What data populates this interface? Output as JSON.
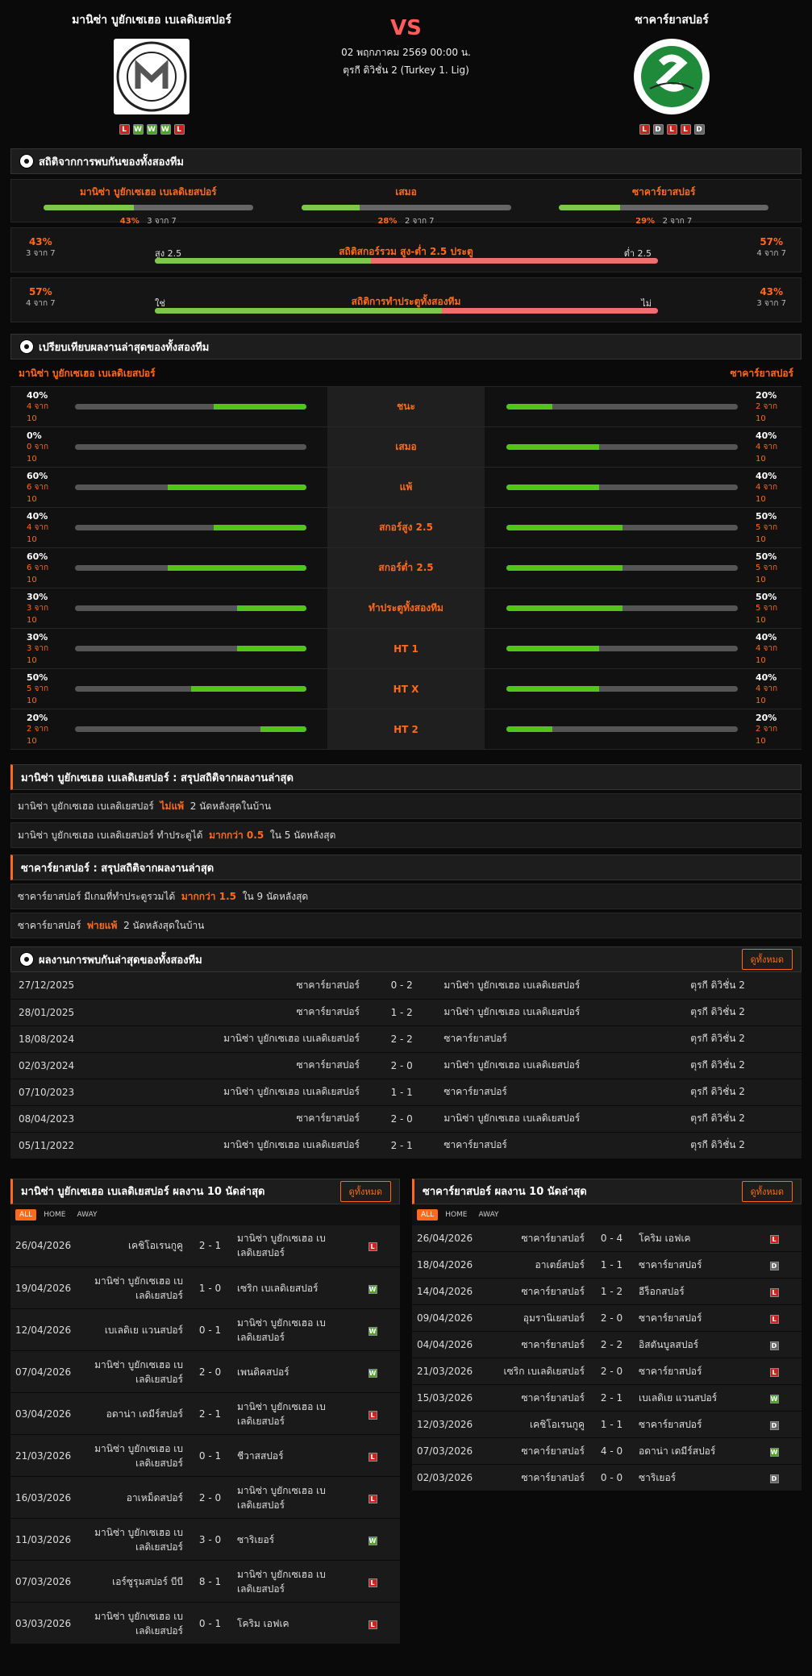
{
  "match": {
    "home": "มานิซ่า บูยักเซเฮอ เบเลดิเยสปอร์",
    "away": "ซาคาร์ยาสปอร์",
    "vs": "VS",
    "datetime": "02 พฤกภาคม 2569 00:00 น.",
    "league": "ตุรกี ดิวิชั่น 2 (Turkey 1. Lig)",
    "home_form": [
      "L",
      "W",
      "W",
      "W",
      "L"
    ],
    "away_form": [
      "L",
      "D",
      "L",
      "L",
      "D"
    ],
    "home_logo_text": "Manisa Futbol Kulübü 2019",
    "away_logo_text": "SAKARYASPOR"
  },
  "h2h_stats": {
    "title": "สถิติจากการพบกันของทั้งสองทีม",
    "home": {
      "label": "มานิซ่า บูยักเซเฮอ เบเลดิเยสปอร์",
      "pct": "43%",
      "count": "3 จาก 7",
      "value": 0.43
    },
    "draw": {
      "label": "เสมอ",
      "pct": "28%",
      "count": "2 จาก 7",
      "value": 0.28
    },
    "away": {
      "label": "ซาคาร์ยาสปอร์",
      "pct": "29%",
      "count": "2 จาก 7",
      "value": 0.29
    },
    "ou": {
      "title": "สถิติสกอร์รวม สูง-ต่ำ 2.5 ประตู",
      "left_pct": "43%",
      "left_count": "3 จาก 7",
      "left_label": "สูง 2.5",
      "right_label": "ต่ำ 2.5",
      "right_pct": "57%",
      "right_count": "4 จาก 7",
      "value": 0.43
    },
    "btts": {
      "title": "สถิติการทำประตูทั้งสองทีม",
      "left_pct": "57%",
      "left_count": "4 จาก 7",
      "left_label": "ใช่",
      "right_label": "ไม่",
      "right_pct": "43%",
      "right_count": "3 จาก 7",
      "value": 0.57
    }
  },
  "compare": {
    "title": "เปรียบเทียบผลงานล่าสุดของทั้งสองทีม",
    "home": "มานิซ่า บูยักเซเฮอ เบเลดิเยสปอร์",
    "away": "ซาคาร์ยาสปอร์",
    "rows": [
      {
        "label": "ชนะ",
        "hp": "40%",
        "hc": "4 จาก 10",
        "hv": 0.4,
        "ap": "20%",
        "ac": "2 จาก 10",
        "av": 0.2
      },
      {
        "label": "เสมอ",
        "hp": "0%",
        "hc": "0 จาก 10",
        "hv": 0,
        "ap": "40%",
        "ac": "4 จาก 10",
        "av": 0.4
      },
      {
        "label": "แพ้",
        "hp": "60%",
        "hc": "6 จาก 10",
        "hv": 0.6,
        "ap": "40%",
        "ac": "4 จาก 10",
        "av": 0.4
      },
      {
        "label": "สกอร์สูง 2.5",
        "hp": "40%",
        "hc": "4 จาก 10",
        "hv": 0.4,
        "ap": "50%",
        "ac": "5 จาก 10",
        "av": 0.5
      },
      {
        "label": "สกอร์ต่ำ 2.5",
        "hp": "60%",
        "hc": "6 จาก 10",
        "hv": 0.6,
        "ap": "50%",
        "ac": "5 จาก 10",
        "av": 0.5
      },
      {
        "label": "ทำประตูทั้งสองทีม",
        "hp": "30%",
        "hc": "3 จาก 10",
        "hv": 0.3,
        "ap": "50%",
        "ac": "5 จาก 10",
        "av": 0.5
      },
      {
        "label": "HT 1",
        "hp": "30%",
        "hc": "3 จาก 10",
        "hv": 0.3,
        "ap": "40%",
        "ac": "4 จาก 10",
        "av": 0.4
      },
      {
        "label": "HT X",
        "hp": "50%",
        "hc": "5 จาก 10",
        "hv": 0.5,
        "ap": "40%",
        "ac": "4 จาก 10",
        "av": 0.4
      },
      {
        "label": "HT 2",
        "hp": "20%",
        "hc": "2 จาก 10",
        "hv": 0.2,
        "ap": "20%",
        "ac": "2 จาก 10",
        "av": 0.2
      }
    ]
  },
  "summary_home": {
    "title": "มานิซ่า บูยักเซเฮอ เบเลดิเยสปอร์ : สรุปสถิติจากผลงานล่าสุด",
    "l1a": "มานิซ่า บูยักเซเฮอ เบเลดิเยสปอร์",
    "l1b": "ไม่แพ้",
    "l1c": "2  นัดหลังสุดในบ้าน",
    "l2a": "มานิซ่า บูยักเซเฮอ เบเลดิเยสปอร์  ทำประตูได้",
    "l2b": "มากกว่า  0.5",
    "l2c": "ใน 5 นัดหลังสุด"
  },
  "summary_away": {
    "title": "ซาคาร์ยาสปอร์ : สรุปสถิติจากผลงานล่าสุด",
    "l1a": "ซาคาร์ยาสปอร์  มีเกมที่ทำประตูรวมได้",
    "l1b": "มากกว่า  1.5",
    "l1c": "ใน 9 นัดหลังสุด",
    "l2a": "ซาคาร์ยาสปอร์",
    "l2b": "พ่ายแพ้",
    "l2c": "2  นัดหลังสุดในบ้าน"
  },
  "h2h": {
    "title": "ผลงานการพบกันล่าสุดของทั้งสองทีม",
    "btn": "ดูทั้งหมด",
    "rows": [
      {
        "date": "27/12/2025",
        "home": "ซาคาร์ยาสปอร์",
        "score": "0 - 2",
        "away": "มานิซ่า บูยักเซเฮอ เบเลดิเยสปอร์",
        "league": "ตุรกี ดิวิชั่น 2"
      },
      {
        "date": "28/01/2025",
        "home": "ซาคาร์ยาสปอร์",
        "score": "1 - 2",
        "away": "มานิซ่า บูยักเซเฮอ เบเลดิเยสปอร์",
        "league": "ตุรกี ดิวิชั่น 2"
      },
      {
        "date": "18/08/2024",
        "home": "มานิซ่า บูยักเซเฮอ เบเลดิเยสปอร์",
        "score": "2 - 2",
        "away": "ซาคาร์ยาสปอร์",
        "league": "ตุรกี ดิวิชั่น 2"
      },
      {
        "date": "02/03/2024",
        "home": "ซาคาร์ยาสปอร์",
        "score": "2 - 0",
        "away": "มานิซ่า บูยักเซเฮอ เบเลดิเยสปอร์",
        "league": "ตุรกี ดิวิชั่น 2"
      },
      {
        "date": "07/10/2023",
        "home": "มานิซ่า บูยักเซเฮอ เบเลดิเยสปอร์",
        "score": "1 - 1",
        "away": "ซาคาร์ยาสปอร์",
        "league": "ตุรกี ดิวิชั่น 2"
      },
      {
        "date": "08/04/2023",
        "home": "ซาคาร์ยาสปอร์",
        "score": "2 - 0",
        "away": "มานิซ่า บูยักเซเฮอ เบเลดิเยสปอร์",
        "league": "ตุรกี ดิวิชั่น 2"
      },
      {
        "date": "05/11/2022",
        "home": "มานิซ่า บูยักเซเฮอ เบเลดิเยสปอร์",
        "score": "2 - 1",
        "away": "ซาคาร์ยาสปอร์",
        "league": "ตุรกี ดิวิชั่น 2"
      }
    ]
  },
  "last_home": {
    "title": "มานิซ่า บูยักเซเฮอ เบเลดิเยสปอร์ ผลงาน 10 นัดล่าสุด",
    "btn": "ดูทั้งหมด",
    "tabs": [
      "ALL",
      "HOME",
      "AWAY"
    ],
    "rows": [
      {
        "date": "26/04/2026",
        "home": "เคชิโอเรนกูคู",
        "score": "2 - 1",
        "away": "มานิซ่า บูยักเซเฮอ เบ เลดิเยสปอร์",
        "r": "L"
      },
      {
        "date": "19/04/2026",
        "home": "มานิซ่า บูยักเซเฮอ เบ เลดิเยสปอร์",
        "score": "1 - 0",
        "away": "เซริก เบเลดิเยสปอร์",
        "r": "W"
      },
      {
        "date": "12/04/2026",
        "home": "เบเลดิเย แวนสปอร์",
        "score": "0 - 1",
        "away": "มานิซ่า บูยักเซเฮอ เบ เลดิเยสปอร์",
        "r": "W"
      },
      {
        "date": "07/04/2026",
        "home": "มานิซ่า บูยักเซเฮอ เบ เลดิเยสปอร์",
        "score": "2 - 0",
        "away": "เพนดิคสปอร์",
        "r": "W"
      },
      {
        "date": "03/04/2026",
        "home": "อดาน่า เดมีร์สปอร์",
        "score": "2 - 1",
        "away": "มานิซ่า บูยักเซเฮอ เบ เลดิเยสปอร์",
        "r": "L"
      },
      {
        "date": "21/03/2026",
        "home": "มานิซ่า บูยักเซเฮอ เบ เลดิเยสปอร์",
        "score": "0 - 1",
        "away": "ชีวาสสปอร์",
        "r": "L"
      },
      {
        "date": "16/03/2026",
        "home": "อาเหม็ดสปอร์",
        "score": "2 - 0",
        "away": "มานิซ่า บูยักเซเฮอ เบ เลดิเยสปอร์",
        "r": "L"
      },
      {
        "date": "11/03/2026",
        "home": "มานิซ่า บูยักเซเฮอ เบ เลดิเยสปอร์",
        "score": "3 - 0",
        "away": "ซาริเยอร์",
        "r": "W"
      },
      {
        "date": "07/03/2026",
        "home": "เอร์ซูรุมสปอร์ บีบี",
        "score": "8 - 1",
        "away": "มานิซ่า บูยักเซเฮอ เบ เลดิเยสปอร์",
        "r": "L"
      },
      {
        "date": "03/03/2026",
        "home": "มานิซ่า บูยักเซเฮอ เบ เลดิเยสปอร์",
        "score": "0 - 1",
        "away": "โคริม เอฟเค",
        "r": "L"
      }
    ]
  },
  "last_away": {
    "title": "ซาคาร์ยาสปอร์ ผลงาน 10 นัดล่าสุด",
    "btn": "ดูทั้งหมด",
    "tabs": [
      "ALL",
      "HOME",
      "AWAY"
    ],
    "rows": [
      {
        "date": "26/04/2026",
        "home": "ซาคาร์ยาสปอร์",
        "score": "0 - 4",
        "away": "โคริม เอฟเค",
        "r": "L"
      },
      {
        "date": "18/04/2026",
        "home": "อาเตย์สปอร์",
        "score": "1 - 1",
        "away": "ซาคาร์ยาสปอร์",
        "r": "D"
      },
      {
        "date": "14/04/2026",
        "home": "ซาคาร์ยาสปอร์",
        "score": "1 - 2",
        "away": "อีร็อกสปอร์",
        "r": "L"
      },
      {
        "date": "09/04/2026",
        "home": "อุมรานิเยสปอร์",
        "score": "2 - 0",
        "away": "ซาคาร์ยาสปอร์",
        "r": "L"
      },
      {
        "date": "04/04/2026",
        "home": "ซาคาร์ยาสปอร์",
        "score": "2 - 2",
        "away": "อิสตันบูลสปอร์",
        "r": "D"
      },
      {
        "date": "21/03/2026",
        "home": "เซริก เบเลดิเยสปอร์",
        "score": "2 - 0",
        "away": "ซาคาร์ยาสปอร์",
        "r": "L"
      },
      {
        "date": "15/03/2026",
        "home": "ซาคาร์ยาสปอร์",
        "score": "2 - 1",
        "away": "เบเลดิเย แวนสปอร์",
        "r": "W"
      },
      {
        "date": "12/03/2026",
        "home": "เคชิโอเรนกูคู",
        "score": "1 - 1",
        "away": "ซาคาร์ยาสปอร์",
        "r": "D"
      },
      {
        "date": "07/03/2026",
        "home": "ซาคาร์ยาสปอร์",
        "score": "4 - 0",
        "away": "อดาน่า เดมีร์สปอร์",
        "r": "W"
      },
      {
        "date": "02/03/2026",
        "home": "ซาคาร์ยาสปอร์",
        "score": "0 - 0",
        "away": "ซาริเยอร์",
        "r": "D"
      }
    ]
  }
}
